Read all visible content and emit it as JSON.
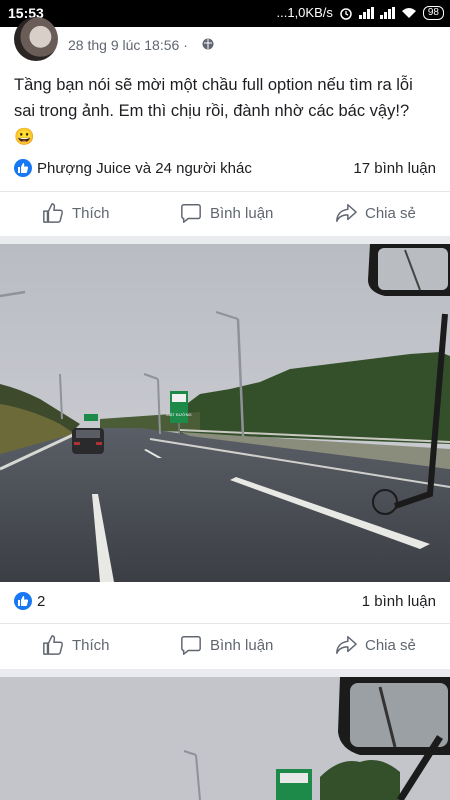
{
  "status_bar": {
    "time": "15:53",
    "network_speed": "...1,0KB/s",
    "battery": "98"
  },
  "post1": {
    "timestamp": "28 thg 9 lúc 18:56 ·",
    "text": "Tầng bạn nói sẽ mời một chầu full option nếu tìm ra lỗi sai trong ảnh. Em thì chịu rồi, đành nhờ các bác vậy!? 😀",
    "reactions": "Phượng Juice và 24 người khác",
    "comments": "17 bình luận"
  },
  "photo1": {
    "sign_text": "MẶT ĐƯỜNG"
  },
  "post2": {
    "reactions": "2",
    "comments": "1 bình luận"
  },
  "actions": {
    "like": "Thích",
    "comment": "Bình luận",
    "share": "Chia sẻ"
  },
  "colors": {
    "accent": "#1877f2",
    "divider": "#e9ebee",
    "muted_text": "#606770"
  }
}
